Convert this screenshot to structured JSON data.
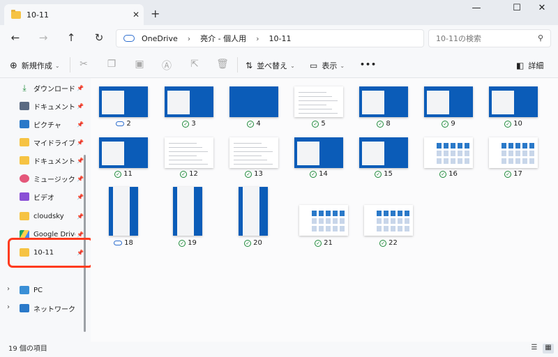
{
  "window": {
    "tab_title": "10-11",
    "new_tab": "+",
    "close_tab": "✕",
    "minimize": "—",
    "maximize": "☐",
    "close": "✕"
  },
  "nav": {
    "back": "←",
    "forward": "→",
    "up": "↑",
    "refresh": "↻"
  },
  "address": {
    "segments": [
      "OneDrive",
      "亮介 - 個人用",
      "10-11"
    ],
    "separator": "›"
  },
  "search": {
    "placeholder": "10-11の検索"
  },
  "toolbar": {
    "new_label": "新規作成",
    "sort_label": "並べ替え",
    "view_label": "表示",
    "more_label": "•••",
    "details_label": "詳細"
  },
  "sidebar": {
    "items": [
      {
        "label": "ダウンロード",
        "icon": "download-icon"
      },
      {
        "label": "ドキュメント",
        "icon": "document-icon"
      },
      {
        "label": "ピクチャ",
        "icon": "picture-icon"
      },
      {
        "label": "マイドライブ",
        "icon": "drive-icon"
      },
      {
        "label": "ドキュメント",
        "icon": "document-icon"
      },
      {
        "label": "ミュージック",
        "icon": "music-icon"
      },
      {
        "label": "ビデオ",
        "icon": "video-icon"
      },
      {
        "label": "cloudsky",
        "icon": "folder-icon"
      },
      {
        "label": "Google Drive",
        "icon": "google-drive-icon"
      },
      {
        "label": "10-11",
        "icon": "folder-icon"
      }
    ],
    "tree": [
      {
        "label": "PC",
        "icon": "pc-icon"
      },
      {
        "label": "ネットワーク",
        "icon": "network-icon"
      }
    ]
  },
  "files": [
    {
      "name": "2",
      "status": "cloud"
    },
    {
      "name": "3",
      "status": "synced"
    },
    {
      "name": "4",
      "status": "synced"
    },
    {
      "name": "5",
      "status": "synced"
    },
    {
      "name": "8",
      "status": "synced"
    },
    {
      "name": "9",
      "status": "synced"
    },
    {
      "name": "10",
      "status": "synced"
    },
    {
      "name": "11",
      "status": "synced"
    },
    {
      "name": "12",
      "status": "synced"
    },
    {
      "name": "13",
      "status": "synced"
    },
    {
      "name": "14",
      "status": "synced"
    },
    {
      "name": "15",
      "status": "synced"
    },
    {
      "name": "16",
      "status": "synced"
    },
    {
      "name": "17",
      "status": "synced"
    },
    {
      "name": "18",
      "status": "cloud"
    },
    {
      "name": "19",
      "status": "synced"
    },
    {
      "name": "20",
      "status": "synced"
    },
    {
      "name": "21",
      "status": "synced"
    },
    {
      "name": "22",
      "status": "synced"
    }
  ],
  "status": {
    "count_text": "19 個の項目"
  },
  "colors": {
    "accent": "#0b5cb8",
    "highlight": "#ff3b1f",
    "folder": "#f6c343"
  }
}
